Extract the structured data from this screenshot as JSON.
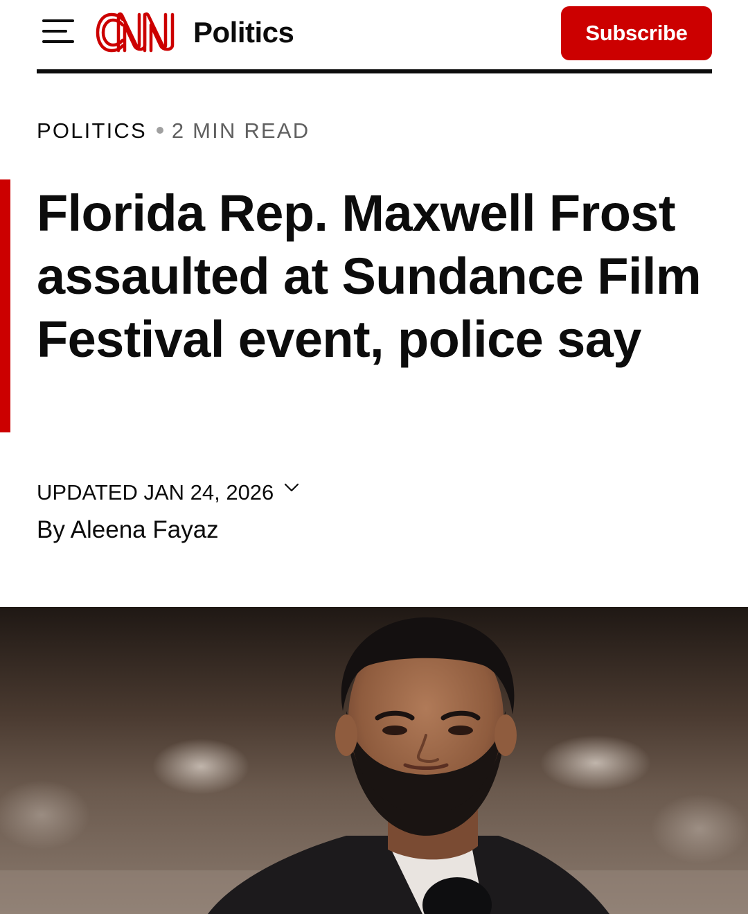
{
  "header": {
    "logo_text": "CNN",
    "section_label": "Politics",
    "subscribe_label": "Subscribe",
    "brand_color": "#cc0000"
  },
  "article": {
    "kicker_category": "POLITICS",
    "kicker_read_time": "2 MIN READ",
    "headline": "Florida Rep. Maxwell Frost assaulted at Sundance Film Festival event, police say",
    "updated": "UPDATED JAN 24, 2026",
    "byline": "By Aleena Fayaz"
  },
  "icons": {
    "menu": "hamburger-menu-icon",
    "timestamp_toggle": "chevron-down-icon"
  }
}
